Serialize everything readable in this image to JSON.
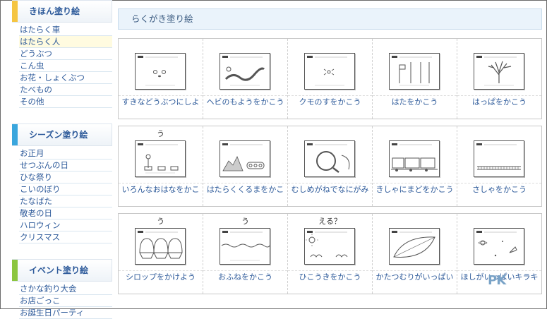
{
  "sidebar": {
    "sections": [
      {
        "title": "きほん塗り絵",
        "accent": "#f5c542",
        "items": [
          "はたらく車",
          "はたらく人",
          "どうぶつ",
          "こん虫",
          "お花・しょくぶつ",
          "たべもの",
          "その他"
        ]
      },
      {
        "title": "シーズン塗り絵",
        "accent": "#3aa6dd",
        "items": [
          "お正月",
          "せつぶんの日",
          "ひな祭り",
          "こいのぼり",
          "たなばた",
          "敬老の日",
          "ハロウィン",
          "クリスマス"
        ]
      },
      {
        "title": "イベント塗り絵",
        "accent": "#8cc63f",
        "items": [
          "さかな釣り大会",
          "お店ごっこ",
          "お誕生日パーティ"
        ]
      }
    ]
  },
  "main": {
    "title": "らくがき塗り絵",
    "rows": [
      {
        "cells": [
          {
            "overflow": "",
            "caption": "すきなどうぶつにしよ",
            "icon": "face-drawing-icon"
          },
          {
            "overflow": "",
            "caption": "ヘビのもようをかこう",
            "icon": "snake-drawing-icon"
          },
          {
            "overflow": "",
            "caption": "クモのすをかこう",
            "icon": "spider-drawing-icon"
          },
          {
            "overflow": "",
            "caption": "はたをかこう",
            "icon": "flag-drawing-icon"
          },
          {
            "overflow": "",
            "caption": "はっぱをかこう",
            "icon": "tree-drawing-icon"
          }
        ]
      },
      {
        "cells": [
          {
            "overflow": "う",
            "caption": "いろんなおはなをかこ",
            "icon": "flower-drawing-icon"
          },
          {
            "overflow": "",
            "caption": "はたらくくるまをかこ",
            "icon": "vehicle-drawing-icon"
          },
          {
            "overflow": "",
            "caption": "むしめがねでなにがみ",
            "icon": "magnifier-drawing-icon"
          },
          {
            "overflow": "",
            "caption": "きしゃにまどをかこう",
            "icon": "train-drawing-icon"
          },
          {
            "overflow": "",
            "caption": "さしゃをかこう",
            "icon": "fence-drawing-icon"
          }
        ]
      },
      {
        "cells": [
          {
            "overflow": "う",
            "caption": "シロップをかけよう",
            "icon": "shaved-ice-drawing-icon"
          },
          {
            "overflow": "う",
            "caption": "おふねをかこう",
            "icon": "sea-drawing-icon"
          },
          {
            "overflow": "える？",
            "caption": "ひこうきをかこう",
            "icon": "sky-drawing-icon"
          },
          {
            "overflow": "",
            "caption": "かたつむりがいっぱい",
            "icon": "leaf-drawing-icon"
          },
          {
            "overflow": "",
            "caption": "ほしがいっぱいキラキ",
            "icon": "space-drawing-icon"
          }
        ]
      }
    ]
  },
  "watermark": "PK"
}
